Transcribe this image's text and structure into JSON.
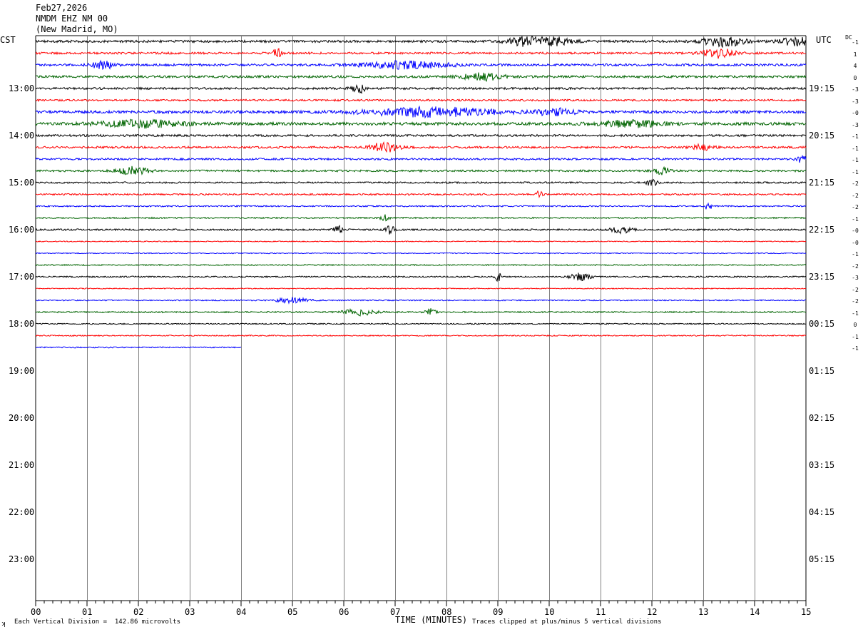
{
  "header": {
    "date": "Feb27,2026",
    "station": "NMDM EHZ NM 00",
    "location": "(New Madrid, MO)"
  },
  "left_tz": "CST",
  "right_tz": "UTC",
  "dc_label": "DC",
  "chart_data": {
    "type": "line",
    "subtype": "helicorder",
    "xlabel": "TIME (MINUTES)",
    "x_ticks": [
      "00",
      "01",
      "02",
      "03",
      "04",
      "05",
      "06",
      "07",
      "08",
      "09",
      "10",
      "11",
      "12",
      "13",
      "14",
      "15"
    ],
    "xlim": [
      0,
      15
    ],
    "left_hour_labels": [
      "13:00",
      "14:00",
      "15:00",
      "16:00",
      "17:00",
      "18:00",
      "19:00",
      "20:00",
      "21:00",
      "22:00",
      "23:00"
    ],
    "right_hour_labels": [
      "19:15",
      "20:15",
      "21:15",
      "22:15",
      "23:15",
      "00:15",
      "01:15",
      "02:15",
      "03:15",
      "04:15",
      "05:15"
    ],
    "trace_colors": [
      "#000000",
      "#ff0000",
      "#0000ff",
      "#006400"
    ],
    "traces": [
      {
        "dc": "-1",
        "end_minute": 15,
        "noise": 1.0,
        "bursts": [
          [
            9.8,
            3.0,
            0.5
          ],
          [
            13.4,
            2.2,
            0.4
          ],
          [
            14.8,
            1.8,
            0.3
          ]
        ]
      },
      {
        "dc": "1",
        "end_minute": 15,
        "noise": 0.9,
        "bursts": [
          [
            4.7,
            1.8,
            0.1
          ],
          [
            13.3,
            2.0,
            0.3
          ]
        ]
      },
      {
        "dc": "4",
        "end_minute": 15,
        "noise": 1.0,
        "bursts": [
          [
            1.3,
            2.0,
            0.2
          ],
          [
            7.2,
            1.6,
            0.8
          ]
        ]
      },
      {
        "dc": "0",
        "end_minute": 15,
        "noise": 1.0,
        "bursts": [
          [
            8.7,
            1.6,
            0.4
          ]
        ]
      },
      {
        "dc": "-3",
        "end_minute": 15,
        "noise": 0.9,
        "bursts": [
          [
            6.3,
            1.8,
            0.15
          ]
        ]
      },
      {
        "dc": "-3",
        "end_minute": 15,
        "noise": 0.8,
        "bursts": []
      },
      {
        "dc": "-0",
        "end_minute": 15,
        "noise": 1.2,
        "bursts": [
          [
            7.7,
            2.0,
            1.2
          ],
          [
            10.1,
            1.4,
            0.4
          ]
        ]
      },
      {
        "dc": "-3",
        "end_minute": 15,
        "noise": 1.3,
        "bursts": [
          [
            2.1,
            1.5,
            0.8
          ],
          [
            11.6,
            1.4,
            0.6
          ]
        ]
      },
      {
        "dc": "-1",
        "end_minute": 15,
        "noise": 0.9,
        "bursts": []
      },
      {
        "dc": "-1",
        "end_minute": 15,
        "noise": 0.9,
        "bursts": [
          [
            6.8,
            2.6,
            0.25
          ],
          [
            13.0,
            1.4,
            0.2
          ]
        ]
      },
      {
        "dc": "-1",
        "end_minute": 15,
        "noise": 0.8,
        "bursts": [
          [
            14.9,
            1.6,
            0.1
          ]
        ]
      },
      {
        "dc": "-1",
        "end_minute": 15,
        "noise": 0.8,
        "bursts": [
          [
            1.9,
            1.8,
            0.3
          ],
          [
            12.2,
            1.5,
            0.15
          ]
        ]
      },
      {
        "dc": "-2",
        "end_minute": 15,
        "noise": 0.7,
        "bursts": [
          [
            12.0,
            1.6,
            0.1
          ]
        ]
      },
      {
        "dc": "-2",
        "end_minute": 15,
        "noise": 0.7,
        "bursts": [
          [
            9.8,
            2.6,
            0.05
          ]
        ]
      },
      {
        "dc": "-2",
        "end_minute": 15,
        "noise": 0.6,
        "bursts": [
          [
            13.1,
            2.6,
            0.05
          ]
        ]
      },
      {
        "dc": "-1",
        "end_minute": 15,
        "noise": 0.6,
        "bursts": [
          [
            6.8,
            1.4,
            0.1
          ]
        ]
      },
      {
        "dc": "-0",
        "end_minute": 15,
        "noise": 0.7,
        "bursts": [
          [
            5.9,
            2.0,
            0.1
          ],
          [
            6.9,
            1.8,
            0.1
          ],
          [
            11.4,
            1.4,
            0.2
          ]
        ]
      },
      {
        "dc": "-0",
        "end_minute": 15,
        "noise": 0.4,
        "bursts": []
      },
      {
        "dc": "-1",
        "end_minute": 15,
        "noise": 0.4,
        "bursts": []
      },
      {
        "dc": "-2",
        "end_minute": 15,
        "noise": 0.5,
        "bursts": []
      },
      {
        "dc": "-3",
        "end_minute": 15,
        "noise": 0.6,
        "bursts": [
          [
            9.0,
            2.6,
            0.05
          ],
          [
            10.6,
            1.5,
            0.2
          ]
        ]
      },
      {
        "dc": "-2",
        "end_minute": 15,
        "noise": 0.4,
        "bursts": []
      },
      {
        "dc": "-2",
        "end_minute": 15,
        "noise": 0.5,
        "bursts": [
          [
            5.0,
            1.2,
            0.3
          ]
        ]
      },
      {
        "dc": "-1",
        "end_minute": 15,
        "noise": 0.6,
        "bursts": [
          [
            6.3,
            1.4,
            0.3
          ],
          [
            7.7,
            1.5,
            0.1
          ]
        ]
      },
      {
        "dc": "0",
        "end_minute": 15,
        "noise": 0.5,
        "bursts": []
      },
      {
        "dc": "-1",
        "end_minute": 15,
        "noise": 0.5,
        "bursts": []
      },
      {
        "dc": "-1",
        "end_minute": 4,
        "noise": 0.5,
        "bursts": []
      }
    ]
  },
  "footer": {
    "scale": "Each Vertical Division =  142.86 microvolts",
    "clip": "Traces clipped at plus/minus 5 vertical divisions",
    "corner": "ʞ"
  }
}
